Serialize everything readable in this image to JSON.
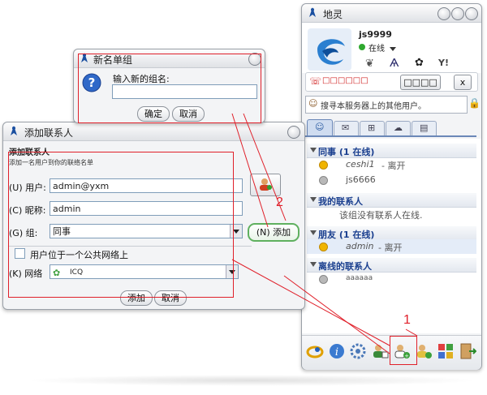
{
  "main": {
    "title": "地灵",
    "username": "js9999",
    "status": "在线",
    "status_icons": [
      "butterfly-icon",
      "runner-icon",
      "flower-icon",
      "yahoo-icon"
    ],
    "phone_text": "□□□□□□",
    "phone_button": "□□□□",
    "phone_close": "x",
    "search_placeholder": "搜寻本服务器上的其他用户。",
    "groups": [
      {
        "title": "同事 (1 在线)",
        "contacts": [
          {
            "name": "ceshi1",
            "note": " - 离开",
            "status": "away"
          },
          {
            "name": "js6666",
            "note": "",
            "status": "offline"
          }
        ]
      },
      {
        "title": "我的联系人",
        "empty_text": "该组没有联系人在线."
      },
      {
        "title": "朋友 (1 在线)",
        "contacts": [
          {
            "name": "admin",
            "note": " - 离开",
            "status": "away"
          }
        ]
      },
      {
        "title": "离线的联系人",
        "contacts": [
          {
            "name": "aaaaaa",
            "note": "",
            "status": "offline"
          }
        ]
      }
    ],
    "toolbar_icons": [
      "aim-icon",
      "info-icon",
      "settings-icon",
      "add-user-icon",
      "add-contact-icon",
      "add-group-icon",
      "apps-icon",
      "exit-icon"
    ]
  },
  "new_group": {
    "title": "新名单组",
    "prompt": "输入新的组名:",
    "input_value": "",
    "ok": "确定",
    "cancel": "取消"
  },
  "add_contact": {
    "title": "添加联系人",
    "heading": "添加联系人",
    "subheading": "添加一名用户到你的联络名单",
    "user_label": "(U) 用户:",
    "user_value": "admin@yxm",
    "nick_label": "(C) 昵称:",
    "nick_value": "admin",
    "group_label": "(G) 组:",
    "group_value": "同事",
    "add_side_button": "(N) 添加",
    "public_checkbox_label": "用户位于一个公共网络上",
    "network_label": "(K) 网络",
    "network_value": "ICQ",
    "add_button": "添加",
    "cancel_button": "取消"
  },
  "annotations": {
    "marker_1": "1",
    "marker_2": "2"
  },
  "colors": {
    "annotation_red": "#e0202a",
    "group_title": "#1a3f8f",
    "away": "#f0b400",
    "offline": "#a0a0a0"
  }
}
